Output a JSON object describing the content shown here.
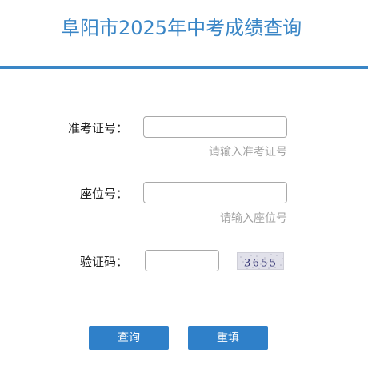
{
  "header": {
    "title": "阜阳市2025年中考成绩查询"
  },
  "form": {
    "exam_id": {
      "label": "准考证号：",
      "value": "",
      "hint": "请输入准考证号"
    },
    "seat_no": {
      "label": "座位号：",
      "value": "",
      "hint": "请输入座位号"
    },
    "captcha": {
      "label": "验证码：",
      "value": "",
      "image_text": "3655"
    }
  },
  "buttons": {
    "query_label": "查询",
    "reset_label": "重填"
  },
  "colors": {
    "accent": "#3a86c6",
    "button": "#2f80c9",
    "hint_text": "#a3a3a3",
    "border": "#a9a9a9"
  }
}
